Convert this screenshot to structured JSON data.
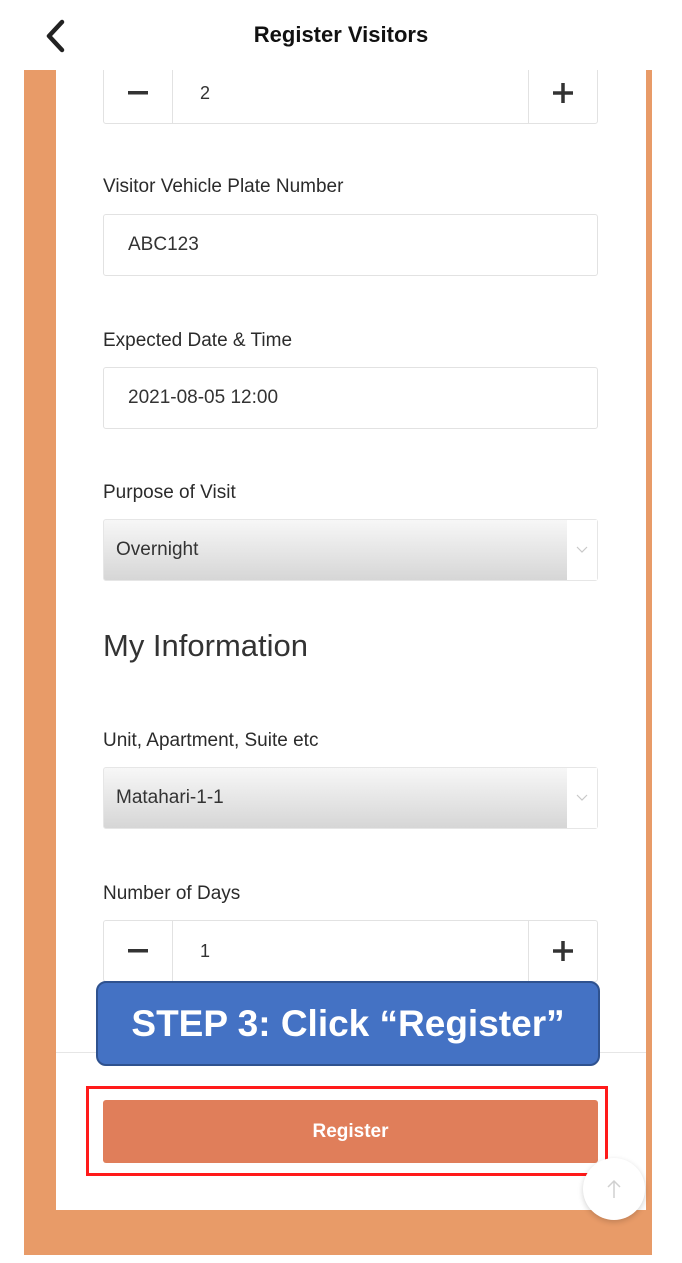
{
  "header": {
    "title": "Register Visitors"
  },
  "form": {
    "visitor_count": {
      "value": "2"
    },
    "vehicle_plate": {
      "label": "Visitor Vehicle Plate Number",
      "value": "ABC123"
    },
    "expected_datetime": {
      "label": "Expected Date & Time",
      "value": "2021-08-05 12:00"
    },
    "purpose": {
      "label": "Purpose of Visit",
      "value": "Overnight"
    }
  },
  "my_info": {
    "title": "My Information",
    "unit": {
      "label": "Unit, Apartment, Suite etc",
      "value": "Matahari-1-1"
    },
    "days": {
      "label": "Number of Days",
      "value": "1"
    }
  },
  "actions": {
    "register_label": "Register"
  },
  "callout": {
    "text": "STEP 3: Click “Register”"
  },
  "colors": {
    "accent_orange": "#e89b68",
    "register_button": "#e07e5a",
    "callout_blue": "#4472c4",
    "highlight_red": "#ff1a1a"
  },
  "icons": {
    "back": "chevron-left-icon",
    "minus": "minus-icon",
    "plus": "plus-icon",
    "dropdown": "chevron-down-icon",
    "scroll_top": "arrow-up-icon"
  }
}
